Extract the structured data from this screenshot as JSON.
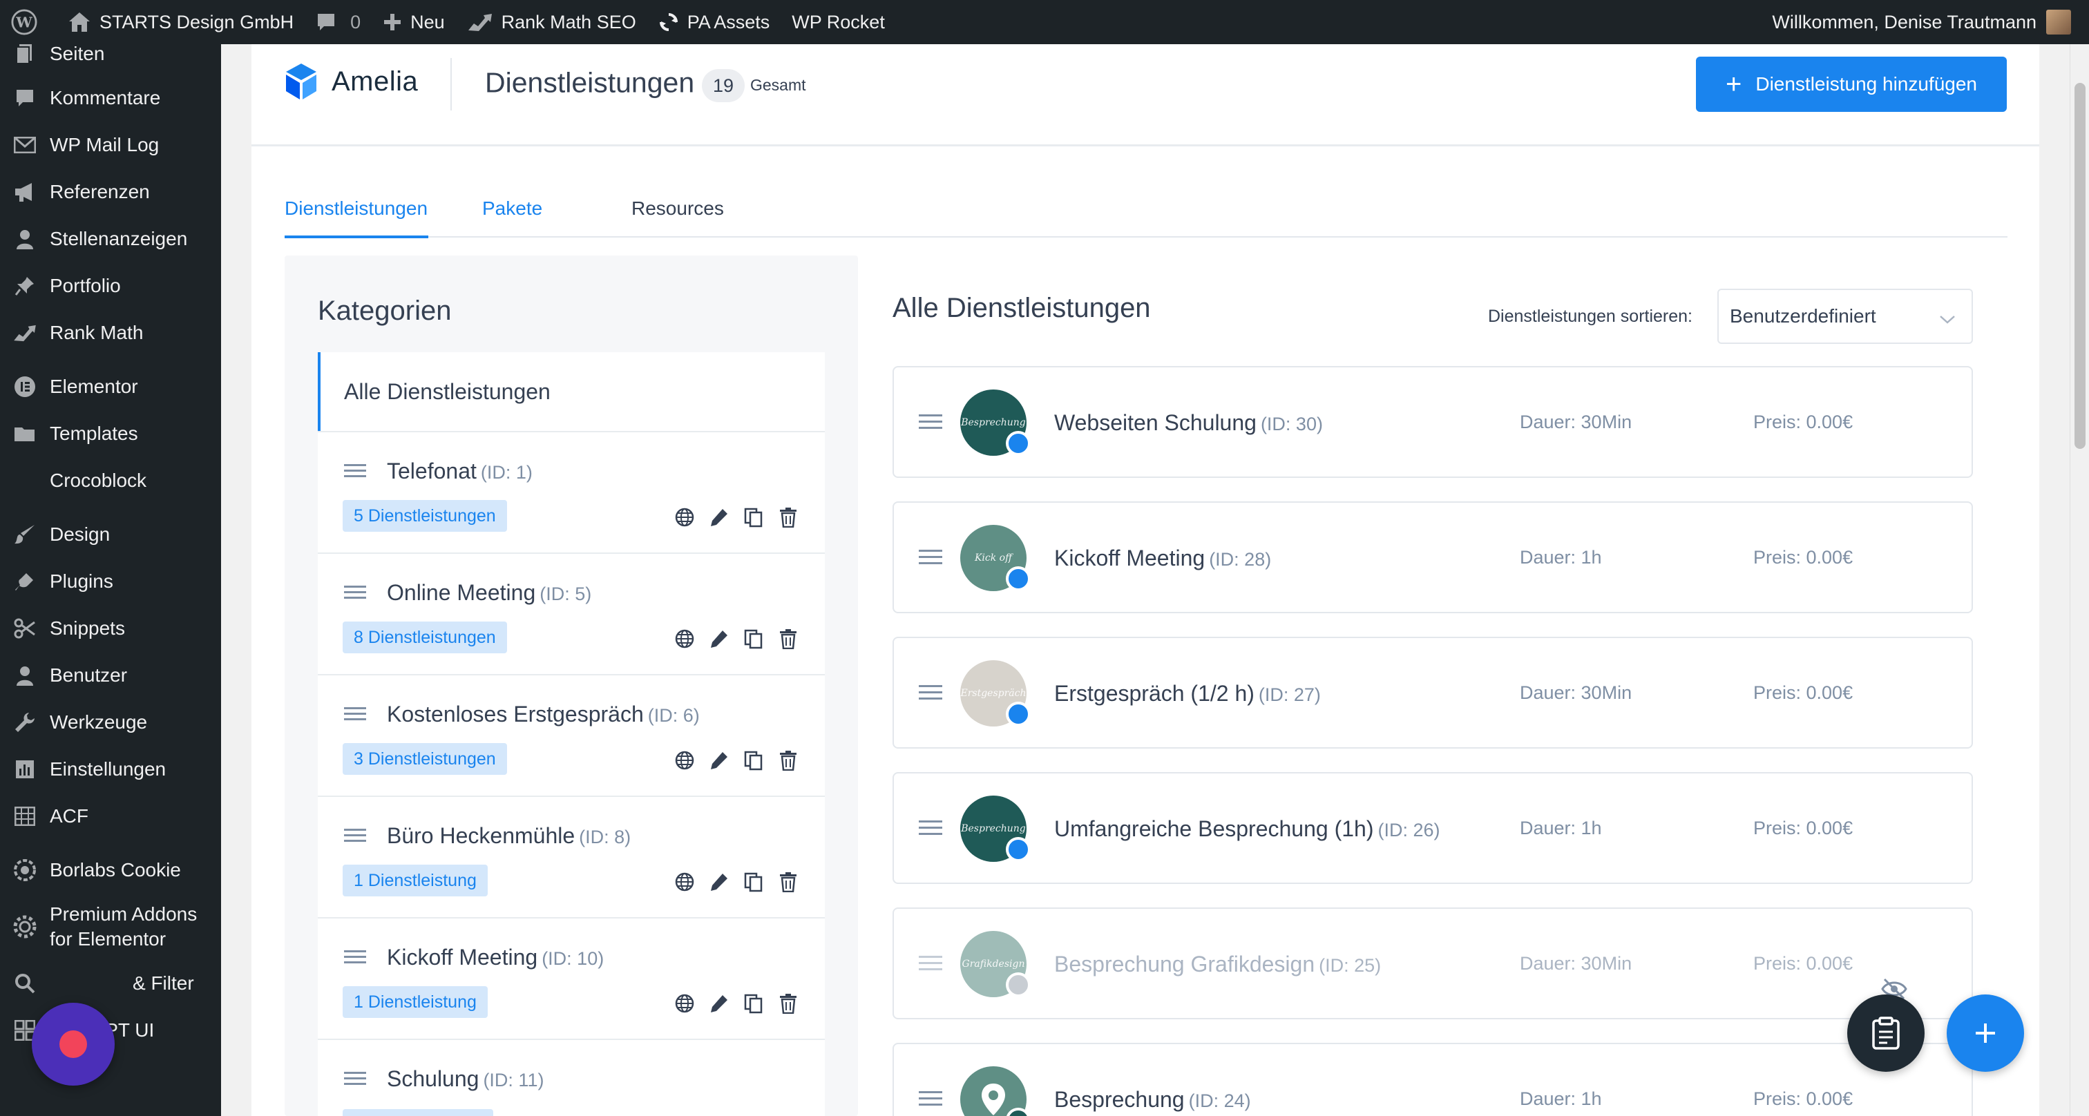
{
  "adminbar": {
    "site_name": "STARTS Design GmbH",
    "comments_count": "0",
    "new_label": "Neu",
    "rankmath_label": "Rank Math SEO",
    "pa_assets_label": "PA Assets",
    "wp_rocket_label": "WP Rocket",
    "welcome_text": "Willkommen, Denise Trautmann"
  },
  "sidebar": {
    "items": [
      {
        "label": "Seiten",
        "icon": "pages-icon"
      },
      {
        "label": "Kommentare",
        "icon": "comment-icon"
      },
      {
        "label": "WP Mail Log",
        "icon": "mail-icon"
      },
      {
        "label": "Referenzen",
        "icon": "megaphone-icon"
      },
      {
        "label": "Stellenanzeigen",
        "icon": "user-icon"
      },
      {
        "label": "Portfolio",
        "icon": "pin-icon"
      },
      {
        "label": "Rank Math",
        "icon": "chart-icon"
      },
      {
        "label": "Elementor",
        "icon": "elementor-icon"
      },
      {
        "label": "Templates",
        "icon": "folder-icon"
      },
      {
        "label": "Crocoblock",
        "icon": "crescent-icon"
      },
      {
        "label": "Design",
        "icon": "brush-icon"
      },
      {
        "label": "Plugins",
        "icon": "plug-icon"
      },
      {
        "label": "Snippets",
        "icon": "scissors-icon"
      },
      {
        "label": "Benutzer",
        "icon": "user-icon"
      },
      {
        "label": "Werkzeuge",
        "icon": "wrench-icon"
      },
      {
        "label": "Einstellungen",
        "icon": "settings-icon"
      },
      {
        "label": "ACF",
        "icon": "grid-icon"
      },
      {
        "label": "Borlabs Cookie",
        "icon": "cookie-icon"
      },
      {
        "label": "Premium Addons for Elementor",
        "label_line1": "Premium Addons",
        "label_line2": "for Elementor",
        "icon": "gear-icon"
      },
      {
        "label": "& Filter",
        "icon": "search-icon"
      },
      {
        "label": "CPT UI",
        "icon": "grid-icon"
      }
    ]
  },
  "header": {
    "logo_text": "Amelia",
    "title": "Dienstleistungen",
    "count": "19",
    "total_label": "Gesamt",
    "add_button": "Dienstleistung hinzufügen"
  },
  "tabs": [
    {
      "label": "Dienstleistungen",
      "active": true
    },
    {
      "label": "Pakete",
      "active": false
    },
    {
      "label": "Resources",
      "active": false
    }
  ],
  "categories": {
    "title": "Kategorien",
    "all_label": "Alle Dienstleistungen",
    "items": [
      {
        "name": "Telefonat",
        "id": "(ID: 1)",
        "badge": "5 Dienstleistungen"
      },
      {
        "name": "Online Meeting",
        "id": "(ID: 5)",
        "badge": "8 Dienstleistungen"
      },
      {
        "name": "Kostenloses Erstgespräch",
        "id": "(ID: 6)",
        "badge": "3 Dienstleistungen"
      },
      {
        "name": "Büro Heckenmühle",
        "id": "(ID: 8)",
        "badge": "1 Dienstleistung"
      },
      {
        "name": "Kickoff Meeting",
        "id": "(ID: 10)",
        "badge": "1 Dienstleistung"
      },
      {
        "name": "Schulung",
        "id": "(ID: 11)",
        "badge": ""
      }
    ]
  },
  "services": {
    "title": "Alle Dienstleistungen",
    "sort_label": "Dienstleistungen sortieren:",
    "sort_value": "Benutzerdefiniert",
    "items": [
      {
        "name": "Webseiten Schulung",
        "id": "(ID: 30)",
        "duration": "Dauer: 30Min",
        "price": "Preis: 0.00€",
        "avatar_text": "Besprechung",
        "avatar_color": "#1f5a57",
        "visible": true
      },
      {
        "name": "Kickoff Meeting",
        "id": "(ID: 28)",
        "duration": "Dauer: 1h",
        "price": "Preis: 0.00€",
        "avatar_text": "Kick off",
        "avatar_color": "#5f8f85",
        "visible": true
      },
      {
        "name": "Erstgespräch (1/2 h)",
        "id": "(ID: 27)",
        "duration": "Dauer: 30Min",
        "price": "Preis: 0.00€",
        "avatar_text": "Erstgespräch",
        "avatar_color": "#d7d3cc",
        "visible": true
      },
      {
        "name": "Umfangreiche Besprechung (1h)",
        "id": "(ID: 26)",
        "duration": "Dauer: 1h",
        "price": "Preis: 0.00€",
        "avatar_text": "Besprechung",
        "avatar_color": "#1f5a57",
        "visible": true
      },
      {
        "name": "Besprechung Grafikdesign",
        "id": "(ID: 25)",
        "duration": "Dauer: 30Min",
        "price": "Preis: 0.00€",
        "avatar_text": "Grafikdesign",
        "avatar_color": "#9fbcb7",
        "visible": false
      },
      {
        "name": "Besprechung",
        "id": "(ID: 24)",
        "duration": "Dauer: 1h",
        "price": "Preis: 0.00€",
        "avatar_text": "",
        "avatar_color": "#5f8f85",
        "visible": true
      }
    ]
  },
  "colors": {
    "accent": "#1a84ee",
    "admin_dark": "#1d2327",
    "badge_bg": "#d4e7fb",
    "text_main": "#354052",
    "text_muted": "#7f8fa4"
  }
}
